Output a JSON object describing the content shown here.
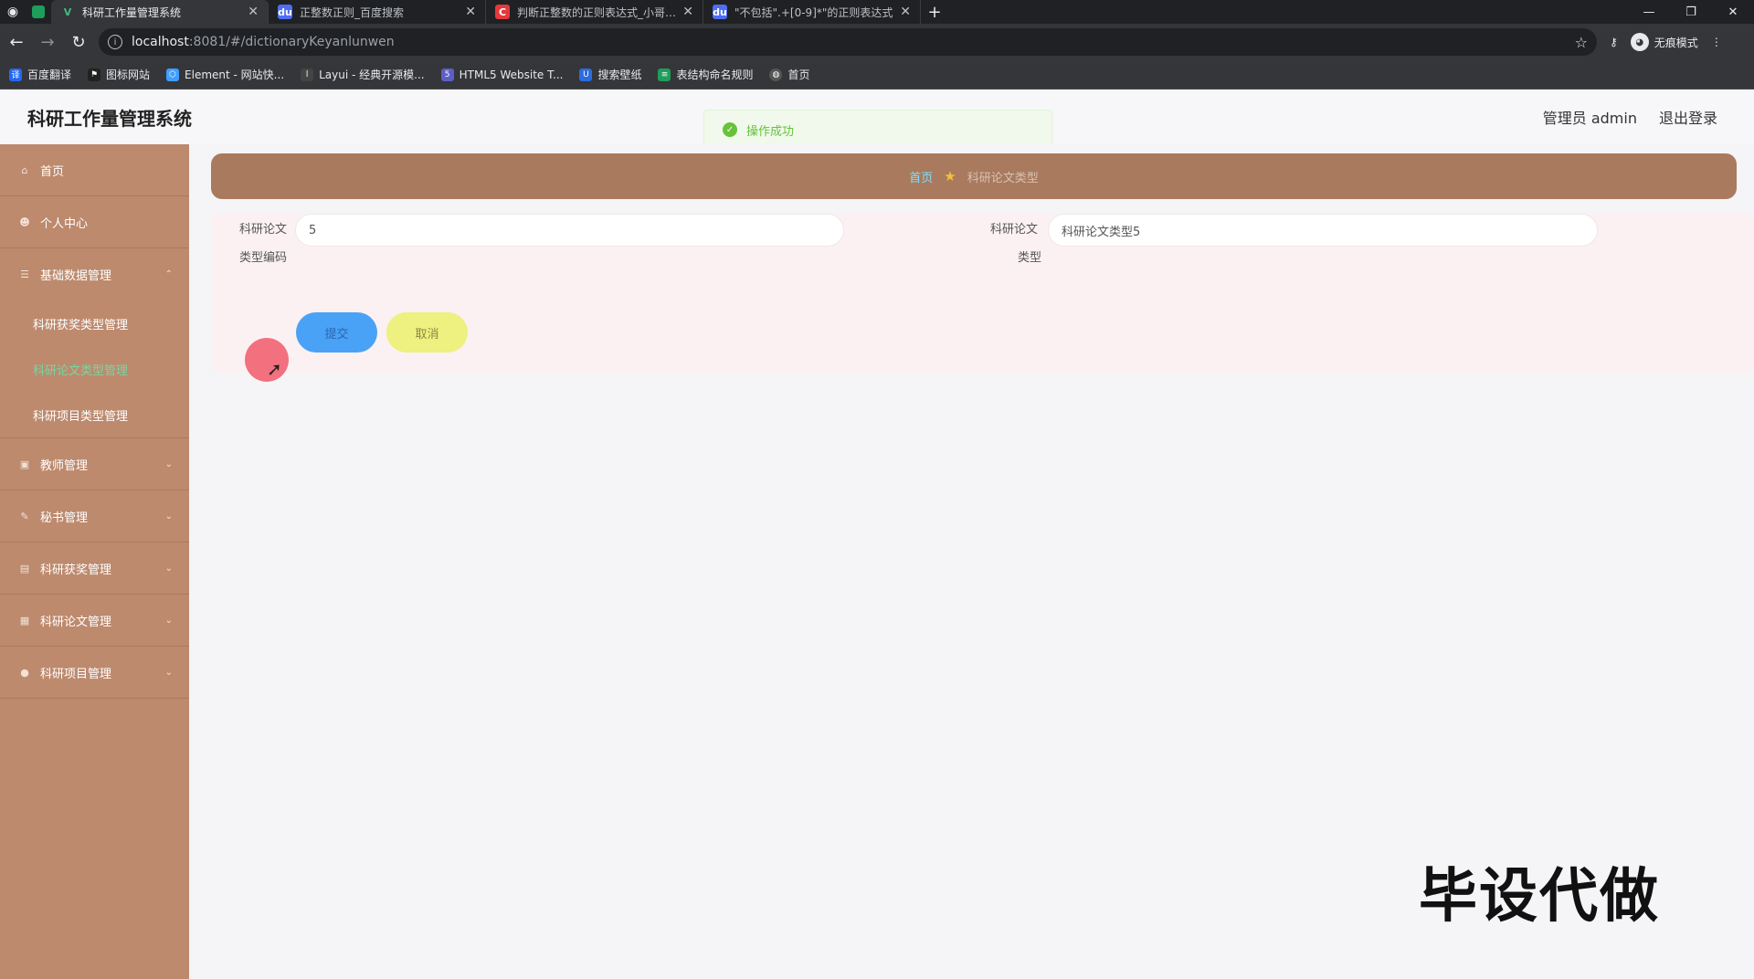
{
  "browser": {
    "tabs": [
      {
        "title": "科研工作量管理系统",
        "icon": "V",
        "color": "#42b883",
        "active": true
      },
      {
        "title": "正整数正则_百度搜索",
        "icon": "du",
        "color": "#4e6ef2",
        "active": false
      },
      {
        "title": "判断正整数的正则表达式_小哥…",
        "icon": "C",
        "color": "#e4393c",
        "active": false
      },
      {
        "title": "\"不包括\".+[0-9]*\"的正则表达式…",
        "icon": "du",
        "color": "#4e6ef2",
        "active": false
      }
    ],
    "url_host": "localhost",
    "url_path": ":8081/#/dictionaryKeyanlunwen",
    "incognito_label": "无痕模式",
    "bookmarks": [
      {
        "label": "百度翻译",
        "color": "#2468f2"
      },
      {
        "label": "图标网站",
        "color": "#555"
      },
      {
        "label": "Element - 网站快...",
        "color": "#409eff"
      },
      {
        "label": "Layui - 经典开源模...",
        "color": "#444"
      },
      {
        "label": "HTML5 Website T...",
        "color": "#5b5fc7"
      },
      {
        "label": "搜索壁纸",
        "color": "#2b6cde"
      },
      {
        "label": "表结构命名规则",
        "color": "#1e9e5a"
      },
      {
        "label": "首页",
        "color": "#555"
      }
    ]
  },
  "app": {
    "title": "科研工作量管理系统",
    "user": "管理员 admin",
    "logout": "退出登录"
  },
  "toast": "操作成功",
  "sidebar": {
    "home": "首页",
    "personal": "个人中心",
    "basic": "基础数据管理",
    "basic_sub": [
      "科研获奖类型管理",
      "科研论文类型管理",
      "科研项目类型管理"
    ],
    "teacher": "教师管理",
    "secretary": "秘书管理",
    "award": "科研获奖管理",
    "paper": "科研论文管理",
    "project": "科研项目管理"
  },
  "breadcrumb": {
    "home": "首页",
    "current": "科研论文类型"
  },
  "form": {
    "code_label_1": "科研论文",
    "code_label_2": "类型编码",
    "code_value": "5",
    "type_label_1": "科研论文",
    "type_label_2": "类型",
    "type_value": "科研论文类型5",
    "submit": "提交",
    "cancel": "取消"
  },
  "watermark": "毕设代做"
}
